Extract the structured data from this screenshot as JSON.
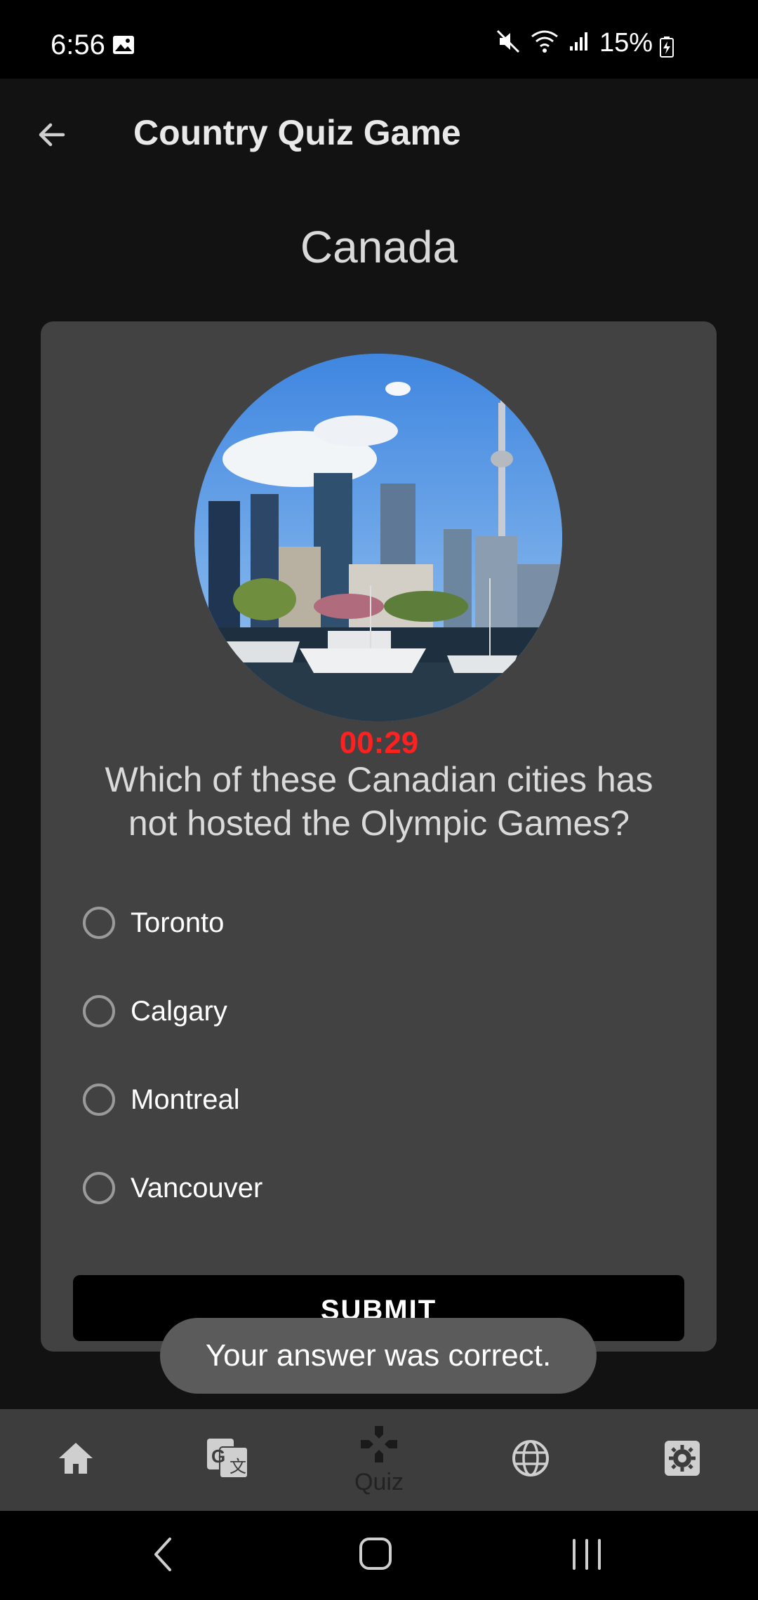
{
  "status_bar": {
    "time": "6:56",
    "battery": "15%"
  },
  "app_bar": {
    "title": "Country Quiz Game"
  },
  "quiz": {
    "country": "Canada",
    "timer": "00:29",
    "question": "Which of these Canadian cities has not hosted the Olympic Games?",
    "options": [
      "Toronto",
      "Calgary",
      "Montreal",
      "Vancouver"
    ],
    "submit_label": "SUBMIT"
  },
  "toast": {
    "message": "Your answer was correct."
  },
  "bottom_nav": {
    "items": [
      {
        "icon": "home-icon",
        "label": ""
      },
      {
        "icon": "translate-icon",
        "label": ""
      },
      {
        "icon": "gamepad-icon",
        "label": "Quiz"
      },
      {
        "icon": "globe-icon",
        "label": ""
      },
      {
        "icon": "settings-icon",
        "label": ""
      }
    ]
  },
  "colors": {
    "timer": "#ff2020",
    "card": "#424242",
    "background": "#121212"
  }
}
